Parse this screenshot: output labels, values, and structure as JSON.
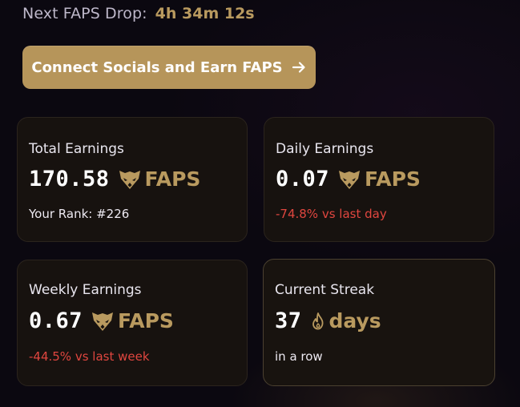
{
  "header": {
    "drop_label": "Next FAPS Drop:",
    "drop_time": "4h 34m 12s"
  },
  "cta": {
    "label": "Connect Socials and Earn FAPS",
    "icon": "arrow-right-icon"
  },
  "cards": {
    "total": {
      "title": "Total Earnings",
      "value": "170.58",
      "unit": "FAPS",
      "sub": "Your Rank: #226"
    },
    "daily": {
      "title": "Daily Earnings",
      "value": "0.07",
      "unit": "FAPS",
      "sub": "-74.8% vs last day"
    },
    "weekly": {
      "title": "Weekly Earnings",
      "value": "0.67",
      "unit": "FAPS",
      "sub": "-44.5% vs last week"
    },
    "streak": {
      "title": "Current Streak",
      "value": "37",
      "unit": "days",
      "sub": "in a row"
    }
  },
  "icons": {
    "token": "fox-icon",
    "streak": "flame-icon"
  },
  "colors": {
    "accent_gold": "#b99a5f",
    "button_gold": "#b6955a",
    "negative": "#e0463f",
    "card_bg": "#17120f",
    "page_bg": "#0b0810"
  }
}
